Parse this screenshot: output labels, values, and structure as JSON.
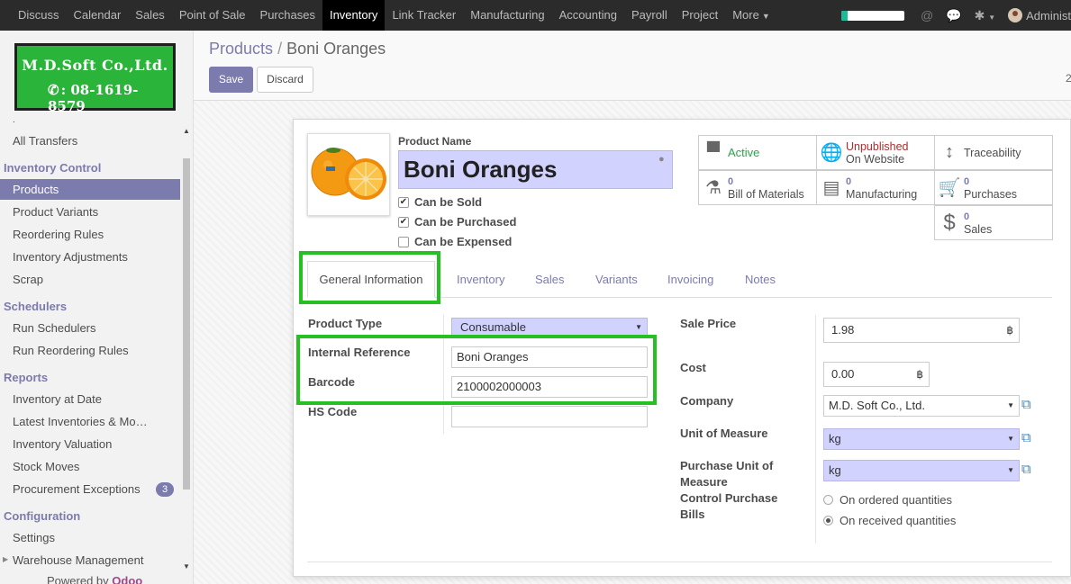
{
  "topnav": {
    "menu": [
      "Discuss",
      "Calendar",
      "Sales",
      "Point of Sale",
      "Purchases",
      "Inventory",
      "Link Tracker",
      "Manufacturing",
      "Accounting",
      "Payroll",
      "Project",
      "More"
    ],
    "active": "Inventory",
    "user": "Administ",
    "progress_percent": 10
  },
  "logo": {
    "company": "M.D.Soft Co.,Ltd.",
    "phone": ": 08-1619-8579"
  },
  "sidebar": {
    "dot": ".",
    "all_transfers": "All Transfers",
    "sections": [
      {
        "title": "Inventory Control",
        "items": [
          "Products",
          "Product Variants",
          "Reordering Rules",
          "Inventory Adjustments",
          "Scrap"
        ]
      },
      {
        "title": "Schedulers",
        "items": [
          "Run Schedulers",
          "Run Reordering Rules"
        ]
      },
      {
        "title": "Reports",
        "items": [
          "Inventory at Date",
          "Latest Inventories & Mo…",
          "Inventory Valuation",
          "Stock Moves",
          "Procurement Exceptions"
        ]
      },
      {
        "title": "Configuration",
        "items": [
          "Settings",
          "Warehouse Management"
        ]
      }
    ],
    "procurement_badge": "3",
    "powered_by": "Powered by",
    "powered_brand": "Odoo"
  },
  "breadcrumb": {
    "parent": "Products",
    "sep": "/",
    "current": "Boni Oranges"
  },
  "buttons": {
    "save": "Save",
    "discard": "Discard"
  },
  "pager": "2",
  "product": {
    "name_label": "Product Name",
    "name": "Boni Oranges",
    "checkboxes": [
      {
        "label": "Can be Sold",
        "checked": true
      },
      {
        "label": "Can be Purchased",
        "checked": true
      },
      {
        "label": "Can be Expensed",
        "checked": false
      }
    ]
  },
  "stats": {
    "active": "Active",
    "published_1": "Unpublished",
    "published_2": "On Website",
    "traceability": "Traceability",
    "bom_count": "0",
    "bom_label": "Bill of Materials",
    "mfg_count": "0",
    "mfg_label": "Manufacturing",
    "purch_count": "0",
    "purch_label": "Purchases",
    "sales_count": "0",
    "sales_label": "Sales"
  },
  "tabs": [
    "General Information",
    "Inventory",
    "Sales",
    "Variants",
    "Invoicing",
    "Notes"
  ],
  "fields_left": {
    "product_type_label": "Product Type",
    "product_type": "Consumable",
    "internal_ref_label": "Internal Reference",
    "internal_ref": "Boni Oranges",
    "barcode_label": "Barcode",
    "barcode": "2100002000003",
    "hs_code_label": "HS Code",
    "hs_code": ""
  },
  "fields_right": {
    "sale_price_label": "Sale Price",
    "sale_price": "1.98",
    "currency": "฿",
    "cost_label": "Cost",
    "cost": "0.00",
    "company_label": "Company",
    "company": "M.D. Soft Co., Ltd.",
    "uom_label": "Unit of Measure",
    "uom": "kg",
    "purchase_uom_label_1": "Purchase Unit of",
    "purchase_uom_label_2": "Measure",
    "purchase_uom": "kg",
    "control_label_1": "Control Purchase",
    "control_label_2": "Bills",
    "control_options": [
      "On ordered quantities",
      "On received quantities"
    ],
    "control_selected": "On received quantities"
  },
  "colors": {
    "brand": "#7c7bad",
    "highlight": "#27c024",
    "required": "#d2d2ff",
    "topnav": "#2b2b2b"
  }
}
